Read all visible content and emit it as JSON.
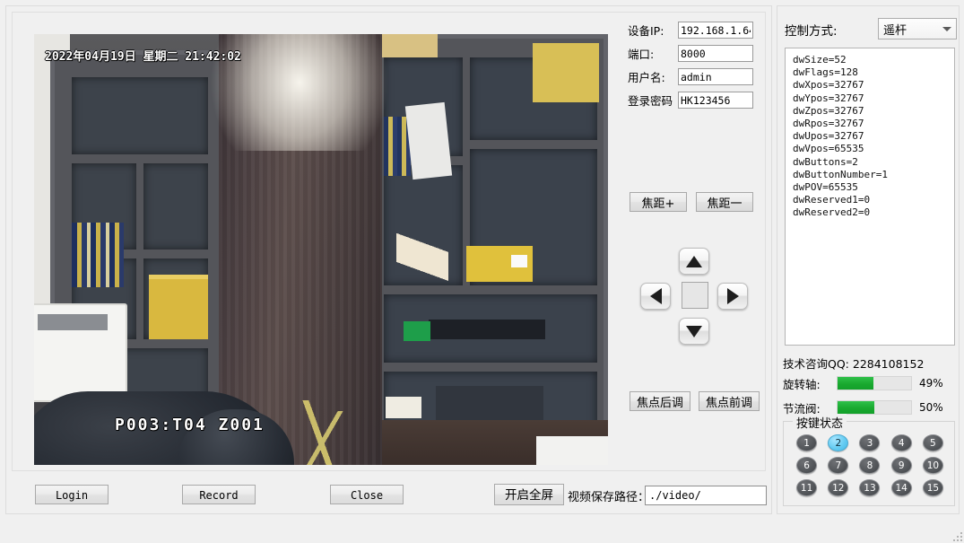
{
  "video": {
    "osd_top": "2022年04月19日  星期二 21:42:02",
    "osd_bottom": "P003:T04   Z001"
  },
  "connection": {
    "fields": [
      {
        "label": "设备IP:",
        "value": "192.168.1.64",
        "name": "device-ip"
      },
      {
        "label": "端口:",
        "value": "8000",
        "name": "port"
      },
      {
        "label": "用户名:",
        "value": "admin",
        "name": "username"
      },
      {
        "label": "登录密码",
        "value": "HK123456",
        "name": "password"
      }
    ]
  },
  "ptz": {
    "zoom_in": "焦距+",
    "zoom_out": "焦距一",
    "focus_near": "焦点后调",
    "focus_far": "焦点前调",
    "up": "▲",
    "down": "▼",
    "left": "◀",
    "right": "▶"
  },
  "bottom": {
    "login": "Login",
    "record": "Record",
    "close": "Close",
    "fullscreen": "开启全屏",
    "path_label": "视频保存路径：",
    "path_value": "./video/"
  },
  "right": {
    "control_mode_label": "控制方式:",
    "control_mode_value": "遥杆",
    "log": "dwSize=52\ndwFlags=128\ndwXpos=32767\ndwYpos=32767\ndwZpos=32767\ndwRpos=32767\ndwUpos=32767\ndwVpos=65535\ndwButtons=2\ndwButtonNumber=1\ndwPOV=65535\ndwReserved1=0\ndwReserved2=0",
    "qq": "技术咨询QQ: 2284108152",
    "meters": [
      {
        "label": "旋转轴:",
        "value": 49,
        "display": "49%",
        "name": "rotation-axis"
      },
      {
        "label": "节流阀:",
        "value": 50,
        "display": "50%",
        "name": "throttle"
      }
    ],
    "button_group_title": "按键状态",
    "buttons": [
      {
        "label": "1",
        "active": false
      },
      {
        "label": "2",
        "active": true
      },
      {
        "label": "3",
        "active": false
      },
      {
        "label": "4",
        "active": false
      },
      {
        "label": "5",
        "active": false
      },
      {
        "label": "6",
        "active": false
      },
      {
        "label": "7",
        "active": false
      },
      {
        "label": "8",
        "active": false
      },
      {
        "label": "9",
        "active": false
      },
      {
        "label": "10",
        "active": false
      },
      {
        "label": "11",
        "active": false
      },
      {
        "label": "12",
        "active": false
      },
      {
        "label": "13",
        "active": false
      },
      {
        "label": "14",
        "active": false
      },
      {
        "label": "15",
        "active": false
      }
    ]
  },
  "colors": {
    "meter_fill": "#19a92f",
    "active_button": "#66ccf2",
    "window_bg": "#f0f0f0"
  }
}
